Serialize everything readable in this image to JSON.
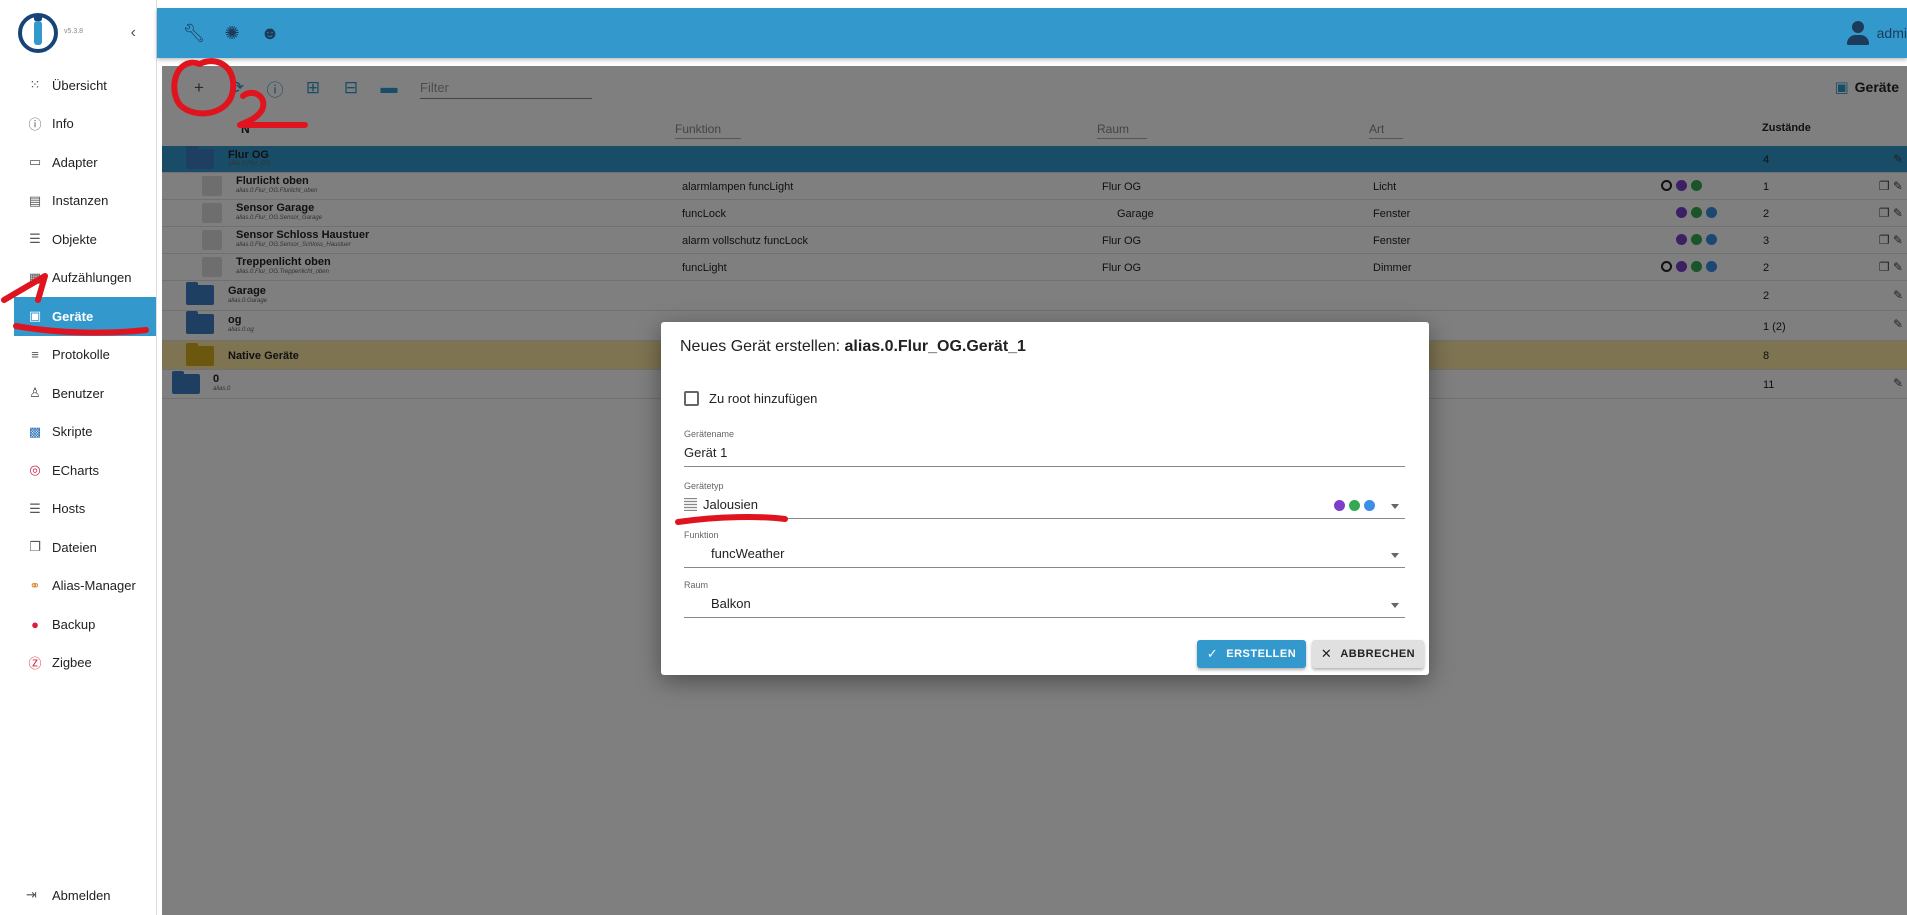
{
  "app": {
    "version": "v5.3.8",
    "user": "admi"
  },
  "sidebar": {
    "items": [
      {
        "label": "Übersicht",
        "icon": "grid-icon"
      },
      {
        "label": "Info",
        "icon": "info-icon"
      },
      {
        "label": "Adapter",
        "icon": "store-icon"
      },
      {
        "label": "Instanzen",
        "icon": "instances-icon"
      },
      {
        "label": "Objekte",
        "icon": "list-icon"
      },
      {
        "label": "Aufzählungen",
        "icon": "enums-icon"
      },
      {
        "label": "Geräte",
        "icon": "devices-icon",
        "active": true
      },
      {
        "label": "Protokolle",
        "icon": "logs-icon"
      },
      {
        "label": "Benutzer",
        "icon": "user-icon"
      },
      {
        "label": "Skripte",
        "icon": "scripts-icon"
      },
      {
        "label": "ECharts",
        "icon": "echarts-icon"
      },
      {
        "label": "Hosts",
        "icon": "hosts-icon"
      },
      {
        "label": "Dateien",
        "icon": "files-icon"
      },
      {
        "label": "Alias-Manager",
        "icon": "alias-icon"
      },
      {
        "label": "Backup",
        "icon": "backup-icon"
      },
      {
        "label": "Zigbee",
        "icon": "zigbee-icon"
      }
    ],
    "logout": "Abmelden"
  },
  "toolbar": {
    "filter_placeholder": "Filter",
    "page_title": "Geräte"
  },
  "table": {
    "headers": {
      "name": "N",
      "funktion": "Funktion",
      "raum": "Raum",
      "art": "Art",
      "zustaende": "Zustände"
    },
    "rows": [
      {
        "kind": "folder",
        "name": "Flur OG",
        "sub": "alias.0.Flur_OG",
        "count": "4"
      },
      {
        "kind": "device",
        "name": "Flurlicht oben",
        "sub": "alias.0.Flur_OG.Flurlicht_oben",
        "funktion": "alarmlampen  funcLight",
        "raum": "Flur OG",
        "art": "Licht",
        "count": "1"
      },
      {
        "kind": "device",
        "name": "Sensor Garage",
        "sub": "alias.0.Flur_OG.Sensor_Garage",
        "funktion": "funcLock",
        "raum": "Garage",
        "art": "Fenster",
        "count": "2"
      },
      {
        "kind": "device",
        "name": "Sensor Schloss Haustuer",
        "sub": "alias.0.Flur_OG.Sensor_Schloss_Haustuer",
        "funktion": "alarm vollschutz  funcLock",
        "raum": "Flur OG",
        "art": "Fenster",
        "count": "3"
      },
      {
        "kind": "device",
        "name": "Treppenlicht oben",
        "sub": "alias.0.Flur_OG.Treppenlicht_oben",
        "funktion": "funcLight",
        "raum": "Flur OG",
        "art": "Dimmer",
        "count": "2"
      },
      {
        "kind": "folder",
        "name": "Garage",
        "sub": "alias.0.Garage",
        "count": "2"
      },
      {
        "kind": "folder",
        "name": "og",
        "sub": "alias.0.og",
        "count": "1 (2)"
      },
      {
        "kind": "native",
        "name": "Native Geräte",
        "sub": "",
        "count": "8"
      },
      {
        "kind": "folder",
        "name": "0",
        "sub": "alias.0",
        "count": "11"
      }
    ]
  },
  "dialog": {
    "title_prefix": "Neues Gerät erstellen:",
    "title_id": "alias.0.Flur_OG.Gerät_1",
    "checkbox_label": "Zu root hinzufügen",
    "name_label": "Gerätename",
    "name_value": "Gerät 1",
    "type_label": "Gerätetyp",
    "type_value": "Jalousien",
    "function_label": "Funktion",
    "function_value": "funcWeather",
    "room_label": "Raum",
    "room_value": "Balkon",
    "create_label": "ERSTELLEN",
    "cancel_label": "ABBRECHEN"
  },
  "colors": {
    "accent": "#3399cc",
    "annotation": "#e0141e"
  }
}
